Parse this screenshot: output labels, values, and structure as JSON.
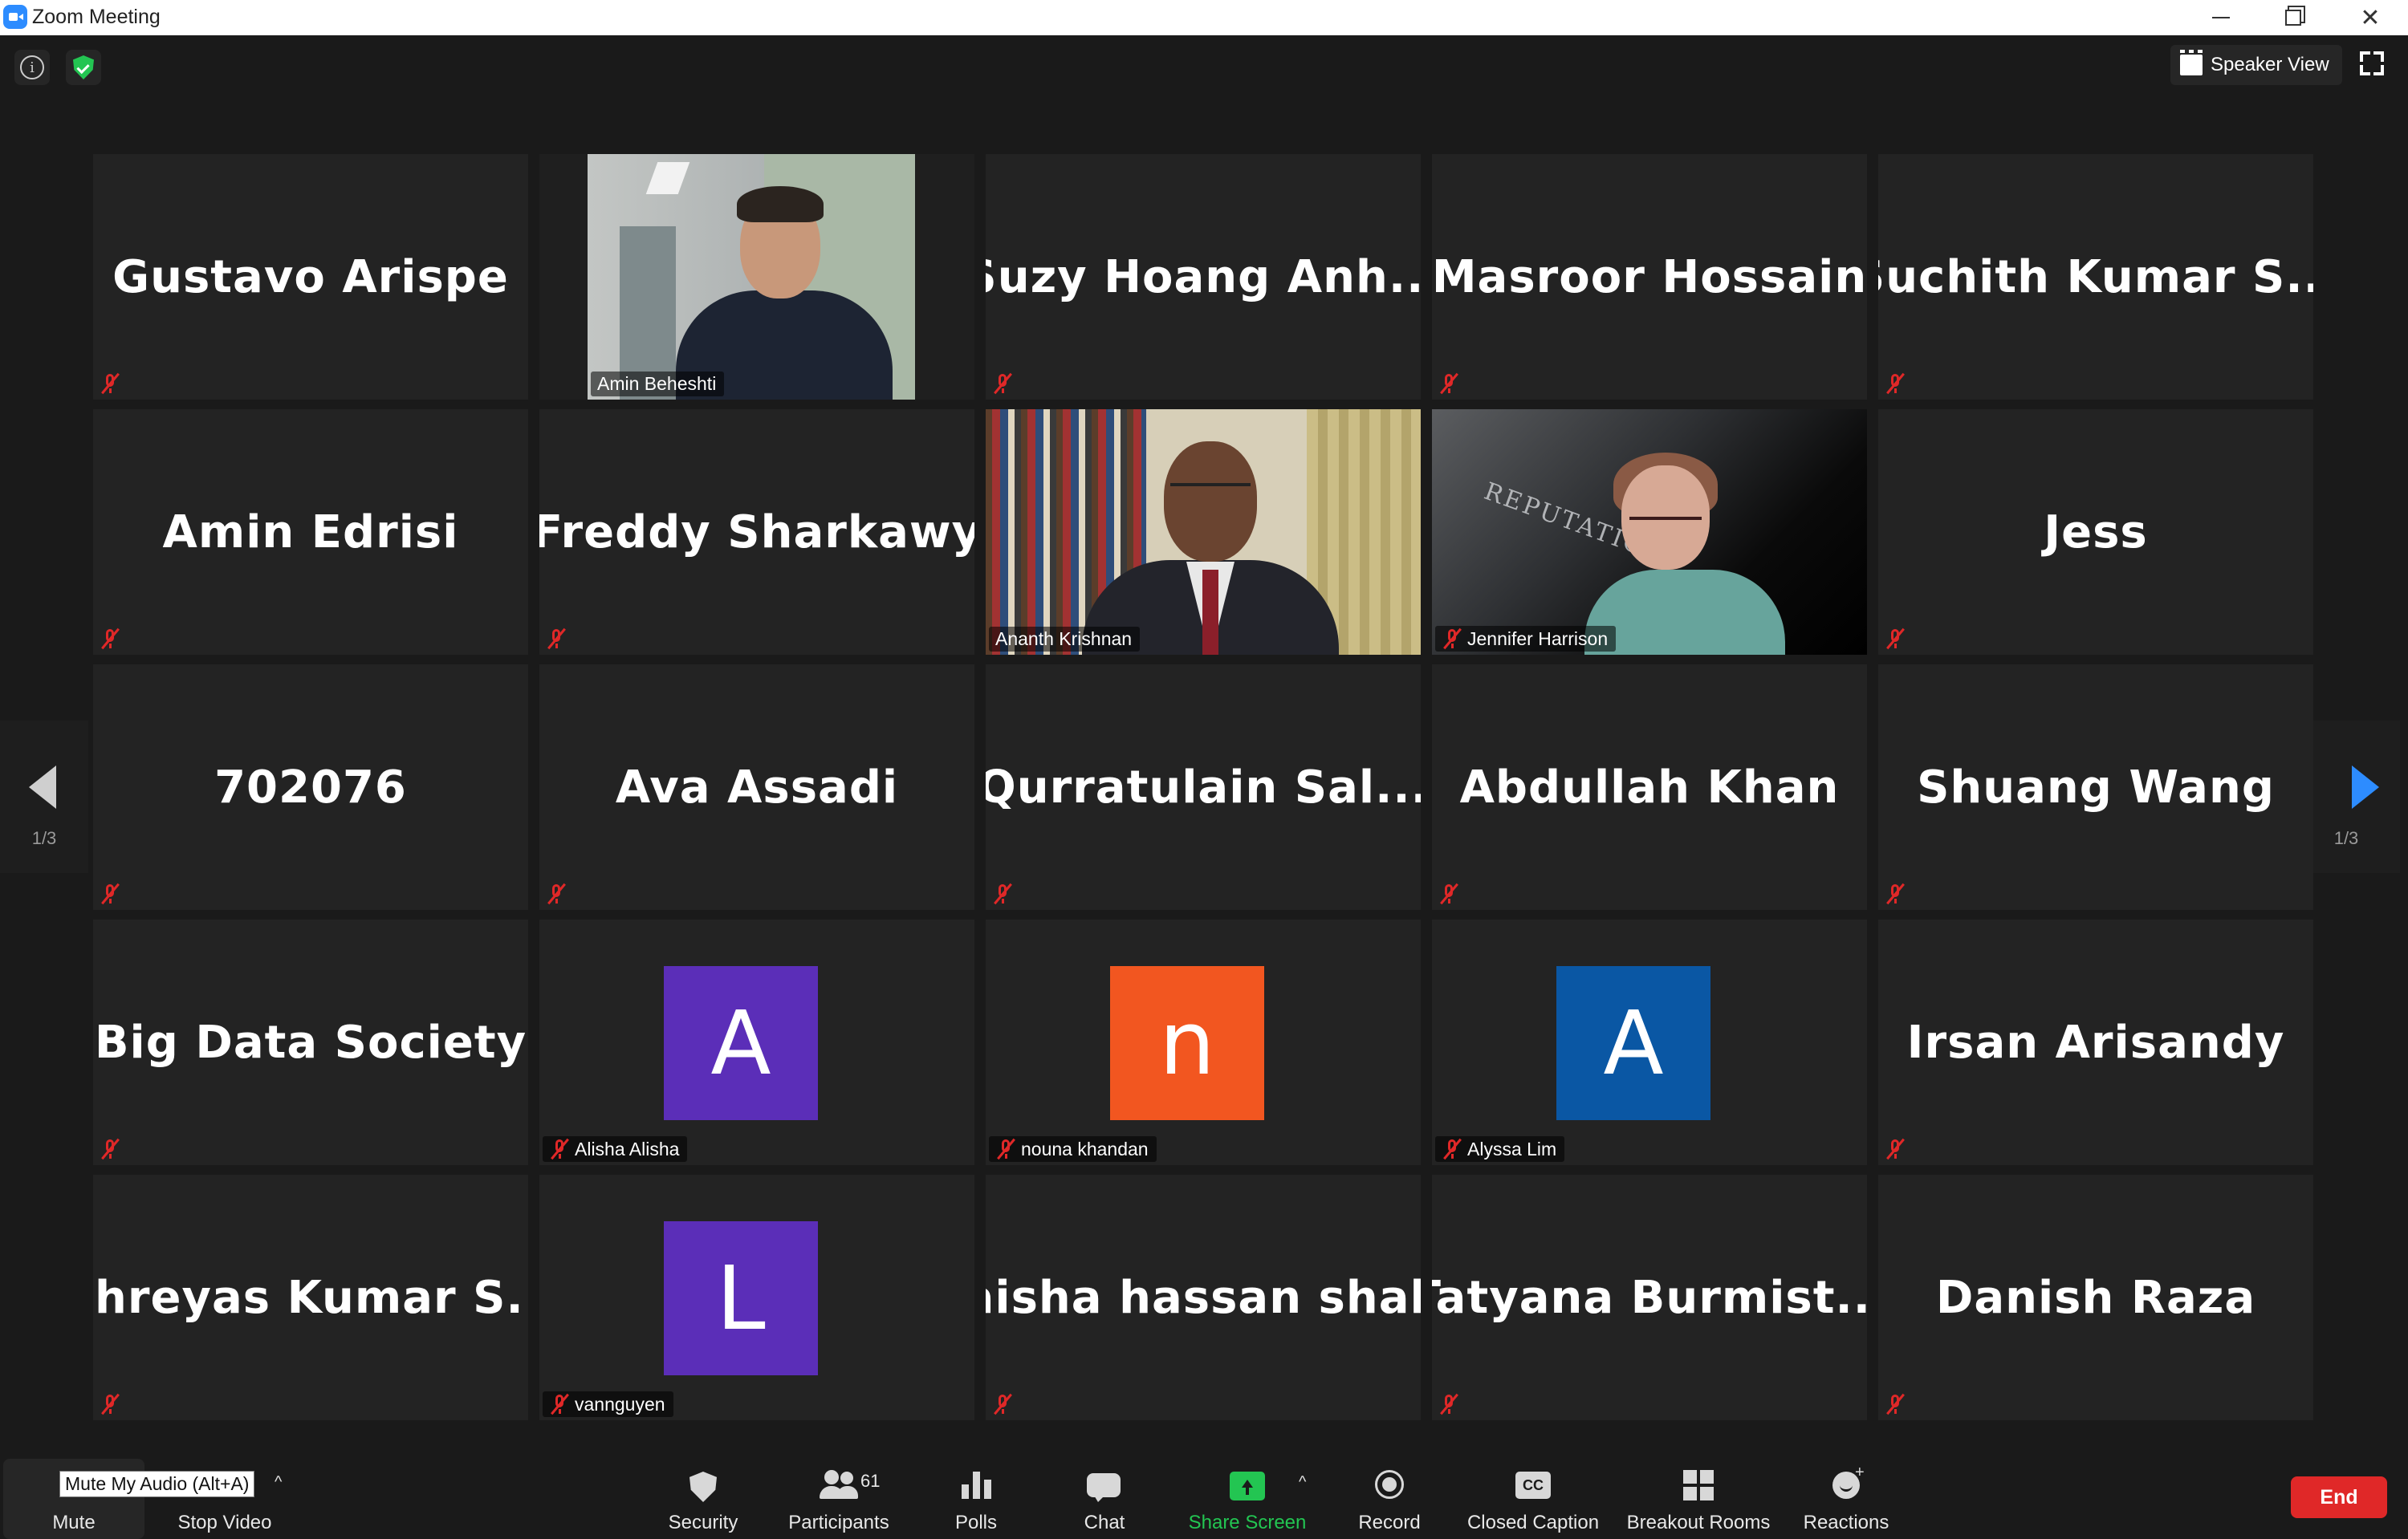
{
  "window": {
    "title": "Zoom Meeting"
  },
  "top_bar": {
    "view_label": "Speaker View"
  },
  "gallery": {
    "page_indicator_left": "1/3",
    "page_indicator_right": "1/3",
    "tiles": [
      {
        "name": "Gustavo Arispe",
        "type": "name",
        "muted": true
      },
      {
        "name": "Amin Beheshti",
        "type": "video",
        "muted": false
      },
      {
        "name": "Suzy Hoang Anh...",
        "type": "name",
        "muted": true
      },
      {
        "name": "Masroor Hossain",
        "type": "name",
        "muted": true
      },
      {
        "name": "Suchith Kumar S...",
        "type": "name",
        "muted": true
      },
      {
        "name": "Amin Edrisi",
        "type": "name",
        "muted": true
      },
      {
        "name": "Freddy Sharkawy",
        "type": "name",
        "muted": true
      },
      {
        "name": "Ananth Krishnan",
        "type": "video",
        "muted": false,
        "active_speaker": true
      },
      {
        "name": "Jennifer Harrison",
        "type": "video",
        "muted": true
      },
      {
        "name": "Jess",
        "type": "name",
        "muted": true
      },
      {
        "name": "702076",
        "type": "name",
        "muted": true
      },
      {
        "name": "Ava Assadi",
        "type": "name",
        "muted": true
      },
      {
        "name": "Qurratulain Sal...",
        "type": "name",
        "muted": true
      },
      {
        "name": "Abdullah Khan",
        "type": "name",
        "muted": true
      },
      {
        "name": "Shuang Wang",
        "type": "name",
        "muted": true
      },
      {
        "name": "Big Data Society",
        "type": "name",
        "muted": true
      },
      {
        "name": "Alisha Alisha",
        "type": "avatar",
        "letter": "A",
        "color": "#5b2eb8",
        "muted": true
      },
      {
        "name": "nouna khandan",
        "type": "avatar",
        "letter": "n",
        "color": "#f25620",
        "muted": true
      },
      {
        "name": "Alyssa Lim",
        "type": "avatar",
        "letter": "A",
        "color": "#0a57a4",
        "muted": true
      },
      {
        "name": "Irsan Arisandy",
        "type": "name",
        "muted": true
      },
      {
        "name": "Shreyas Kumar S...",
        "type": "name",
        "muted": true
      },
      {
        "name": "vannguyen",
        "type": "avatar",
        "letter": "L",
        "color": "#5b2eb8",
        "muted": true
      },
      {
        "name": "aisha hassan shah",
        "type": "name",
        "muted": true
      },
      {
        "name": "Tatyana  Burmist...",
        "type": "name",
        "muted": true
      },
      {
        "name": "Danish Raza",
        "type": "name",
        "muted": true
      }
    ]
  },
  "toolbar": {
    "mute_tooltip": "Mute My Audio (Alt+A)",
    "mute": "Mute",
    "stop_video": "Stop Video",
    "security": "Security",
    "participants": "Participants",
    "participants_count": "61",
    "polls": "Polls",
    "chat": "Chat",
    "share_screen": "Share Screen",
    "record": "Record",
    "closed_caption": "Closed Caption",
    "breakout_rooms": "Breakout Rooms",
    "reactions": "Reactions",
    "end": "End"
  },
  "colors": {
    "active_speaker_border": "#d9ec7a",
    "share_green": "#23c552",
    "end_red": "#e02828",
    "next_arrow_blue": "#2d8cff"
  }
}
